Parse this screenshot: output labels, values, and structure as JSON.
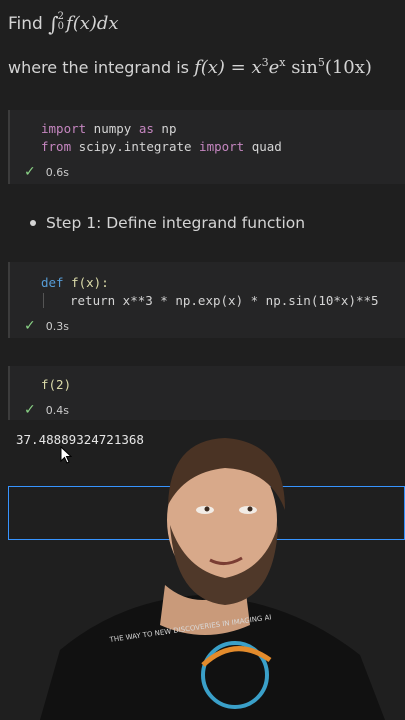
{
  "markdown": {
    "task_prefix": "Find",
    "integral_upper": "2",
    "integral_lower": "0",
    "integrand_expr": "f(x)dx",
    "where_text": "where the integrand is",
    "fx_lhs": "f(x) = ",
    "fx_rhs_base": "x",
    "fx_rhs_exp1": "3",
    "fx_rhs_e": "e",
    "fx_rhs_expx": "x",
    "fx_rhs_sin": " sin",
    "fx_rhs_exp5": "5",
    "fx_rhs_arg": "(10x)"
  },
  "cells": [
    {
      "lines": [
        [
          "import",
          " numpy ",
          "as",
          " np"
        ],
        [
          "from",
          " scipy.integrate ",
          "import",
          " quad"
        ]
      ],
      "time": "0.6s"
    },
    {
      "def_kw": "def",
      "def_sig": " f(x):",
      "ret_line": "return x**3 * np.exp(x) * np.sin(10*x)**5",
      "time": "0.3s"
    },
    {
      "code": "f(2)",
      "time": "0.4s"
    }
  ],
  "step1": "Step 1: Define integrand function",
  "output": "37.48889324721368",
  "icons": {
    "check": "check-icon",
    "cursor": "mouse-cursor-icon"
  },
  "colors": {
    "background": "#1f1f1f",
    "cell_background": "#252526",
    "keyword": "#c586c0",
    "success": "#89d185",
    "selection_border": "#3794ff"
  },
  "shirt_text": "THE WAY TO NEW DISCOVERIES IN IMAGING AI"
}
